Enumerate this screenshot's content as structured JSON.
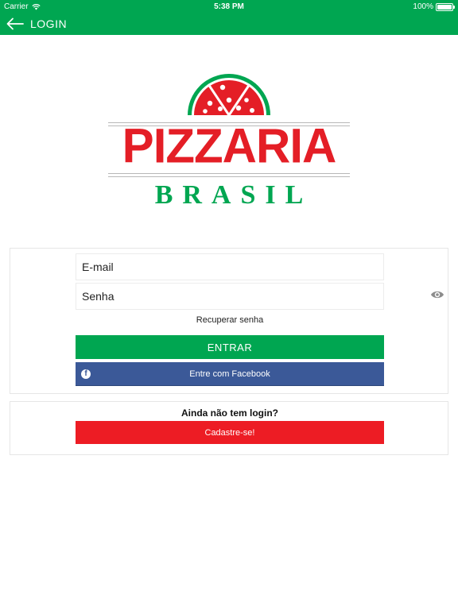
{
  "status_bar": {
    "carrier": "Carrier",
    "time": "5:38 PM",
    "battery": "100%",
    "battery_level": 1.0
  },
  "nav": {
    "title": "LOGIN",
    "back_icon": "arrow-left-icon"
  },
  "logo": {
    "line1": "PIZZARIA",
    "line2": "BRASIL"
  },
  "login_form": {
    "email_placeholder": "E-mail",
    "password_placeholder": "Senha",
    "password_toggle_icon": "eye-icon",
    "recover_label": "Recuperar senha",
    "enter_label": "ENTRAR",
    "facebook_label": "Entre com Facebook",
    "facebook_icon": "facebook-icon"
  },
  "signup": {
    "prompt": "Ainda não tem login?",
    "button_label": "Cadastre-se!"
  },
  "colors": {
    "primary_green": "#00a651",
    "brand_red": "#e41e26",
    "signup_red": "#ed1c24",
    "facebook_blue": "#3b5998"
  }
}
